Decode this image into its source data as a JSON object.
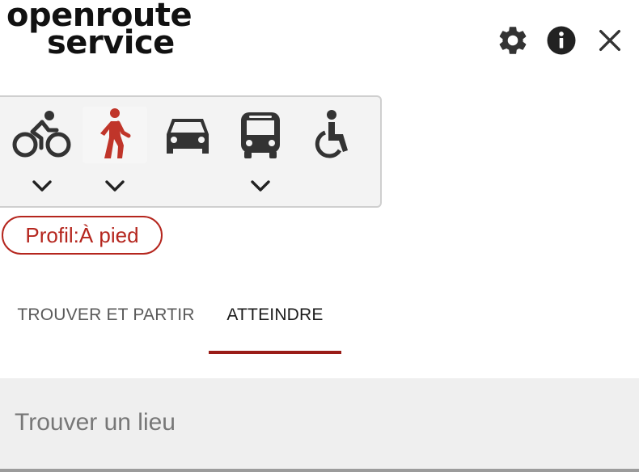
{
  "logo": {
    "line1": "openroute",
    "line2": "service"
  },
  "header_icons": [
    "gear-icon",
    "info-icon",
    "close-icon"
  ],
  "profiles": [
    {
      "name": "bike-icon",
      "has_menu": true,
      "selected": false
    },
    {
      "name": "walk-icon",
      "has_menu": true,
      "selected": true
    },
    {
      "name": "car-icon",
      "has_menu": false,
      "selected": false
    },
    {
      "name": "bus-icon",
      "has_menu": true,
      "selected": false
    },
    {
      "name": "wheelchair-icon",
      "has_menu": false,
      "selected": false
    }
  ],
  "profile_chip": {
    "label": "Profil:À pied"
  },
  "tabs": [
    {
      "label": "TROUVER ET PARTIR",
      "active": false
    },
    {
      "label": "ATTEINDRE",
      "active": true
    }
  ],
  "search": {
    "placeholder": "Trouver un lieu",
    "value": ""
  },
  "colors": {
    "accent": "#b5261e",
    "tab_underline": "#9a1c17",
    "icon_dark": "#333333",
    "profile_bg": "#f3f3f3"
  }
}
